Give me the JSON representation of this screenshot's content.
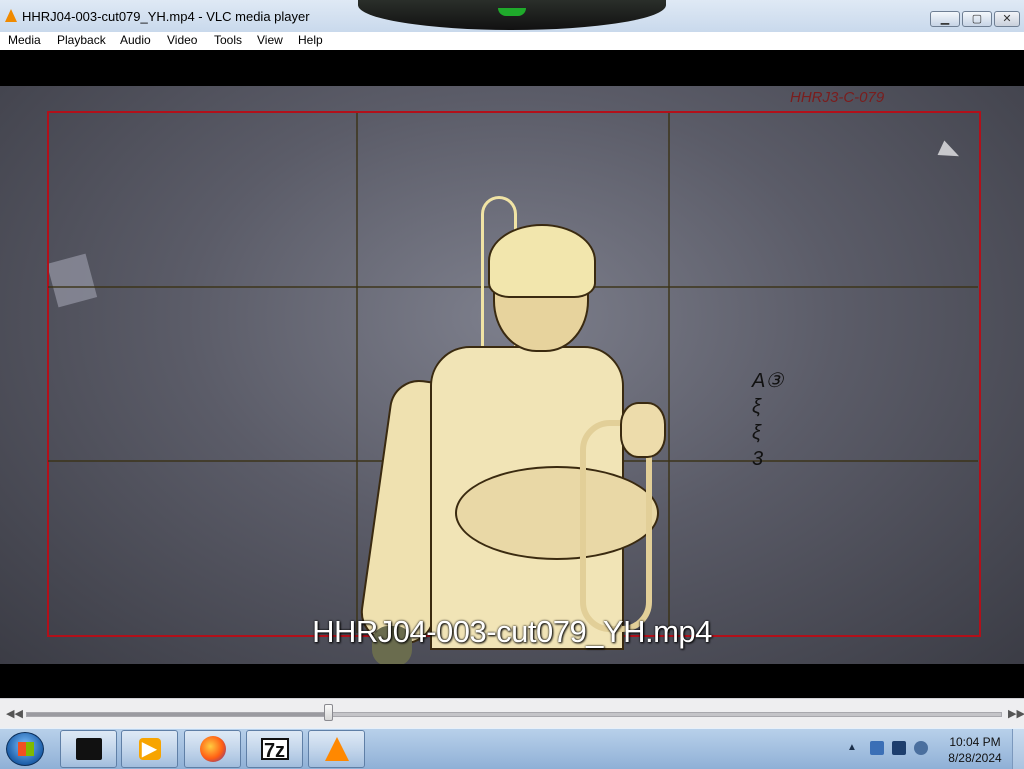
{
  "window": {
    "title": "HHRJ04-003-cut079_YH.mp4 - VLC media player",
    "controls": {
      "minimize": "▁",
      "maximize": "▢",
      "close": "✕"
    }
  },
  "menu": {
    "items": [
      "Media",
      "Playback",
      "Audio",
      "Video",
      "Tools",
      "View",
      "Help"
    ]
  },
  "video": {
    "subtitle": "HHRJ04-003-cut079_YH.mp4",
    "frame_stamp": "HHRJ3-C-079",
    "notes": [
      "A③",
      "ξ",
      "ξ",
      "3"
    ]
  },
  "seek": {
    "position_fraction": 0.31,
    "prev_icon": "◀◀",
    "next_icon": "▶▶"
  },
  "taskbar": {
    "start_icon": "windows-start-icon",
    "apps": [
      {
        "name": "app-black-box",
        "glyph": ""
      },
      {
        "name": "windows-media-player",
        "glyph": "▶"
      },
      {
        "name": "firefox",
        "glyph": ""
      },
      {
        "name": "7zip",
        "glyph": "7z"
      },
      {
        "name": "vlc",
        "glyph": ""
      }
    ],
    "tray_arrow": "▲",
    "clock": {
      "time": "10:04 PM",
      "date": "8/28/2024"
    }
  }
}
